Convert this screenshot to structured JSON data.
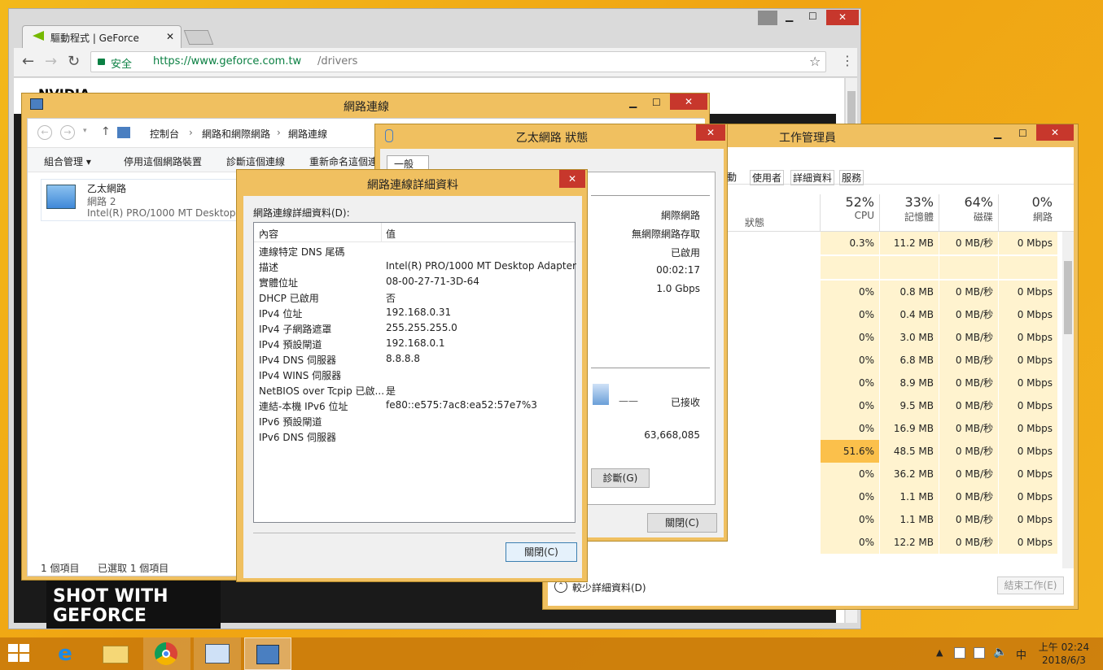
{
  "chrome": {
    "tab_title": "驅動程式 | GeForce",
    "tab_close": "✕",
    "secure": "安全",
    "url_host": "https://www.geforce.com.tw",
    "url_path": "/drivers",
    "star": "☆",
    "menu": "⋮",
    "back": "←",
    "forward": "→",
    "reload": "↻",
    "nvidia_text": "NVIDIA",
    "shot1": "SHOT WITH",
    "shot2": "GEFORCE"
  },
  "netconn": {
    "title": "網路連線",
    "crumbs": [
      "控制台",
      "網路和網際網路",
      "網路連線"
    ],
    "toolbar": [
      "組合管理 ▾",
      "停用這個網路裝置",
      "診斷這個連線",
      "重新命名這個連線"
    ],
    "adapter_name": "乙太網路",
    "adapter_net": "網路 2",
    "adapter_desc": "Intel(R) PRO/1000 MT Desktop ...",
    "status_count": "1 個項目",
    "status_selected": "已選取 1 個項目"
  },
  "ethstatus": {
    "title": "乙太網路 狀態",
    "tab": "一般",
    "values": [
      "網際網路",
      "無網際網路存取",
      "已啟用",
      "00:02:17",
      "1.0 Gbps"
    ],
    "received_label": "已接收",
    "dash": "——",
    "bytes": "63,668,085",
    "diagnose": "診斷(G)",
    "close": "關閉(C)"
  },
  "taskmgr": {
    "title": "工作管理員",
    "tabs": [
      "動",
      "使用者",
      "詳細資料",
      "服務"
    ],
    "status_col": "狀態",
    "cols": [
      {
        "pct": "52%",
        "name": "CPU"
      },
      {
        "pct": "33%",
        "name": "記憶體"
      },
      {
        "pct": "64%",
        "name": "磁碟"
      },
      {
        "pct": "0%",
        "name": "網路"
      }
    ],
    "rows": [
      [
        "0.3%",
        "11.2 MB",
        "0 MB/秒",
        "0 Mbps"
      ],
      [
        "",
        "",
        "",
        ""
      ],
      [
        "0%",
        "0.8 MB",
        "0 MB/秒",
        "0 Mbps"
      ],
      [
        "0%",
        "0.4 MB",
        "0 MB/秒",
        "0 Mbps"
      ],
      [
        "0%",
        "3.0 MB",
        "0 MB/秒",
        "0 Mbps"
      ],
      [
        "0%",
        "6.8 MB",
        "0 MB/秒",
        "0 Mbps"
      ],
      [
        "0%",
        "8.9 MB",
        "0 MB/秒",
        "0 Mbps"
      ],
      [
        "0%",
        "9.5 MB",
        "0 MB/秒",
        "0 Mbps"
      ],
      [
        "0%",
        "16.9 MB",
        "0 MB/秒",
        "0 Mbps"
      ],
      [
        "51.6%",
        "48.5 MB",
        "0 MB/秒",
        "0 Mbps"
      ],
      [
        "0%",
        "36.2 MB",
        "0 MB/秒",
        "0 Mbps"
      ],
      [
        "0%",
        "1.1 MB",
        "0 MB/秒",
        "0 Mbps"
      ],
      [
        "0%",
        "1.1 MB",
        "0 MB/秒",
        "0 Mbps"
      ],
      [
        "0%",
        "12.2 MB",
        "0 MB/秒",
        "0 Mbps"
      ]
    ],
    "fewer": "較少詳細資料(D)",
    "end_task": "結束工作(E)"
  },
  "details": {
    "title": "網路連線詳細資料",
    "label": "網路連線詳細資料(D):",
    "col_prop": "內容",
    "col_val": "值",
    "rows": [
      [
        "連線特定 DNS 尾碼",
        ""
      ],
      [
        "描述",
        "Intel(R) PRO/1000 MT Desktop Adapter"
      ],
      [
        "實體位址",
        "08-00-27-71-3D-64"
      ],
      [
        "DHCP 已啟用",
        "否"
      ],
      [
        "IPv4 位址",
        "192.168.0.31"
      ],
      [
        "IPv4 子網路遮罩",
        "255.255.255.0"
      ],
      [
        "IPv4 預設閘道",
        "192.168.0.1"
      ],
      [
        "IPv4 DNS 伺服器",
        "8.8.8.8"
      ],
      [
        "IPv4 WINS 伺服器",
        ""
      ],
      [
        "NetBIOS over Tcpip 已啟...",
        "是"
      ],
      [
        "連結-本機 IPv6 位址",
        "fe80::e575:7ac8:ea52:57e7%3"
      ],
      [
        "IPv6 預設閘道",
        ""
      ],
      [
        "IPv6 DNS 伺服器",
        ""
      ]
    ],
    "close": "關閉(C)"
  },
  "taskbar": {
    "time": "上午 02:24",
    "date": "2018/6/3",
    "ime": "中"
  },
  "caption": {
    "min": "▁",
    "max": "☐",
    "close": "✕"
  },
  "colors": {
    "accent": "#f0c060",
    "cpu_hot": "#fbc04b",
    "cpu_warm": "#fff3cf"
  }
}
